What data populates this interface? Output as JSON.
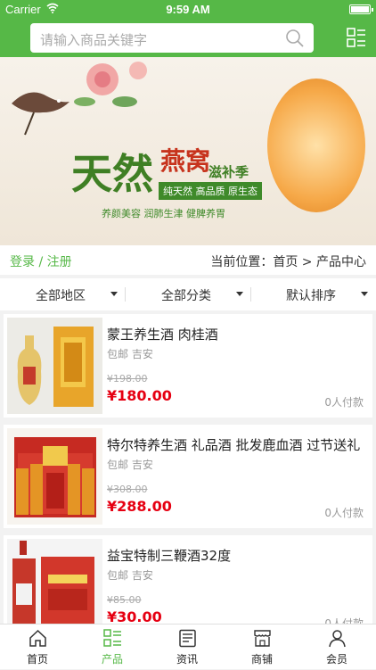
{
  "status": {
    "carrier": "Carrier",
    "time": "9:59 AM"
  },
  "search": {
    "placeholder": "请输入商品关键字"
  },
  "banner": {
    "title_main": "天然",
    "title_accent": "燕窝",
    "title_tail": "滋补季",
    "tagline": "纯天然 高品质 原生态",
    "subline": "养颜美容 润肺生津 健脾养胃"
  },
  "breadcrumb": {
    "login": "登录 / 注册",
    "position": "当前位置：首页 > 产品中心"
  },
  "filters": [
    {
      "label": "全部地区"
    },
    {
      "label": "全部分类"
    },
    {
      "label": "默认排序"
    }
  ],
  "products": [
    {
      "name": "蒙王养生酒 肉桂酒",
      "shipping": "包邮 吉安",
      "old_price": "¥198.00",
      "price": "¥180.00",
      "paid": "0人付款"
    },
    {
      "name": "特尔特养生酒 礼品酒 批发鹿血酒 过节送礼",
      "shipping": "包邮 吉安",
      "old_price": "¥308.00",
      "price": "¥288.00",
      "paid": "0人付款"
    },
    {
      "name": "益宝特制三鞭酒32度",
      "shipping": "包邮 吉安",
      "old_price": "¥85.00",
      "price": "¥30.00",
      "paid": "0人付款"
    }
  ],
  "tabbar": [
    {
      "label": "首页",
      "icon": "home-icon"
    },
    {
      "label": "产品",
      "icon": "product-icon",
      "active": true
    },
    {
      "label": "资讯",
      "icon": "news-icon"
    },
    {
      "label": "商铺",
      "icon": "shop-icon"
    },
    {
      "label": "会员",
      "icon": "member-icon"
    }
  ],
  "colors": {
    "accent": "#56b847",
    "price": "#e60012"
  }
}
